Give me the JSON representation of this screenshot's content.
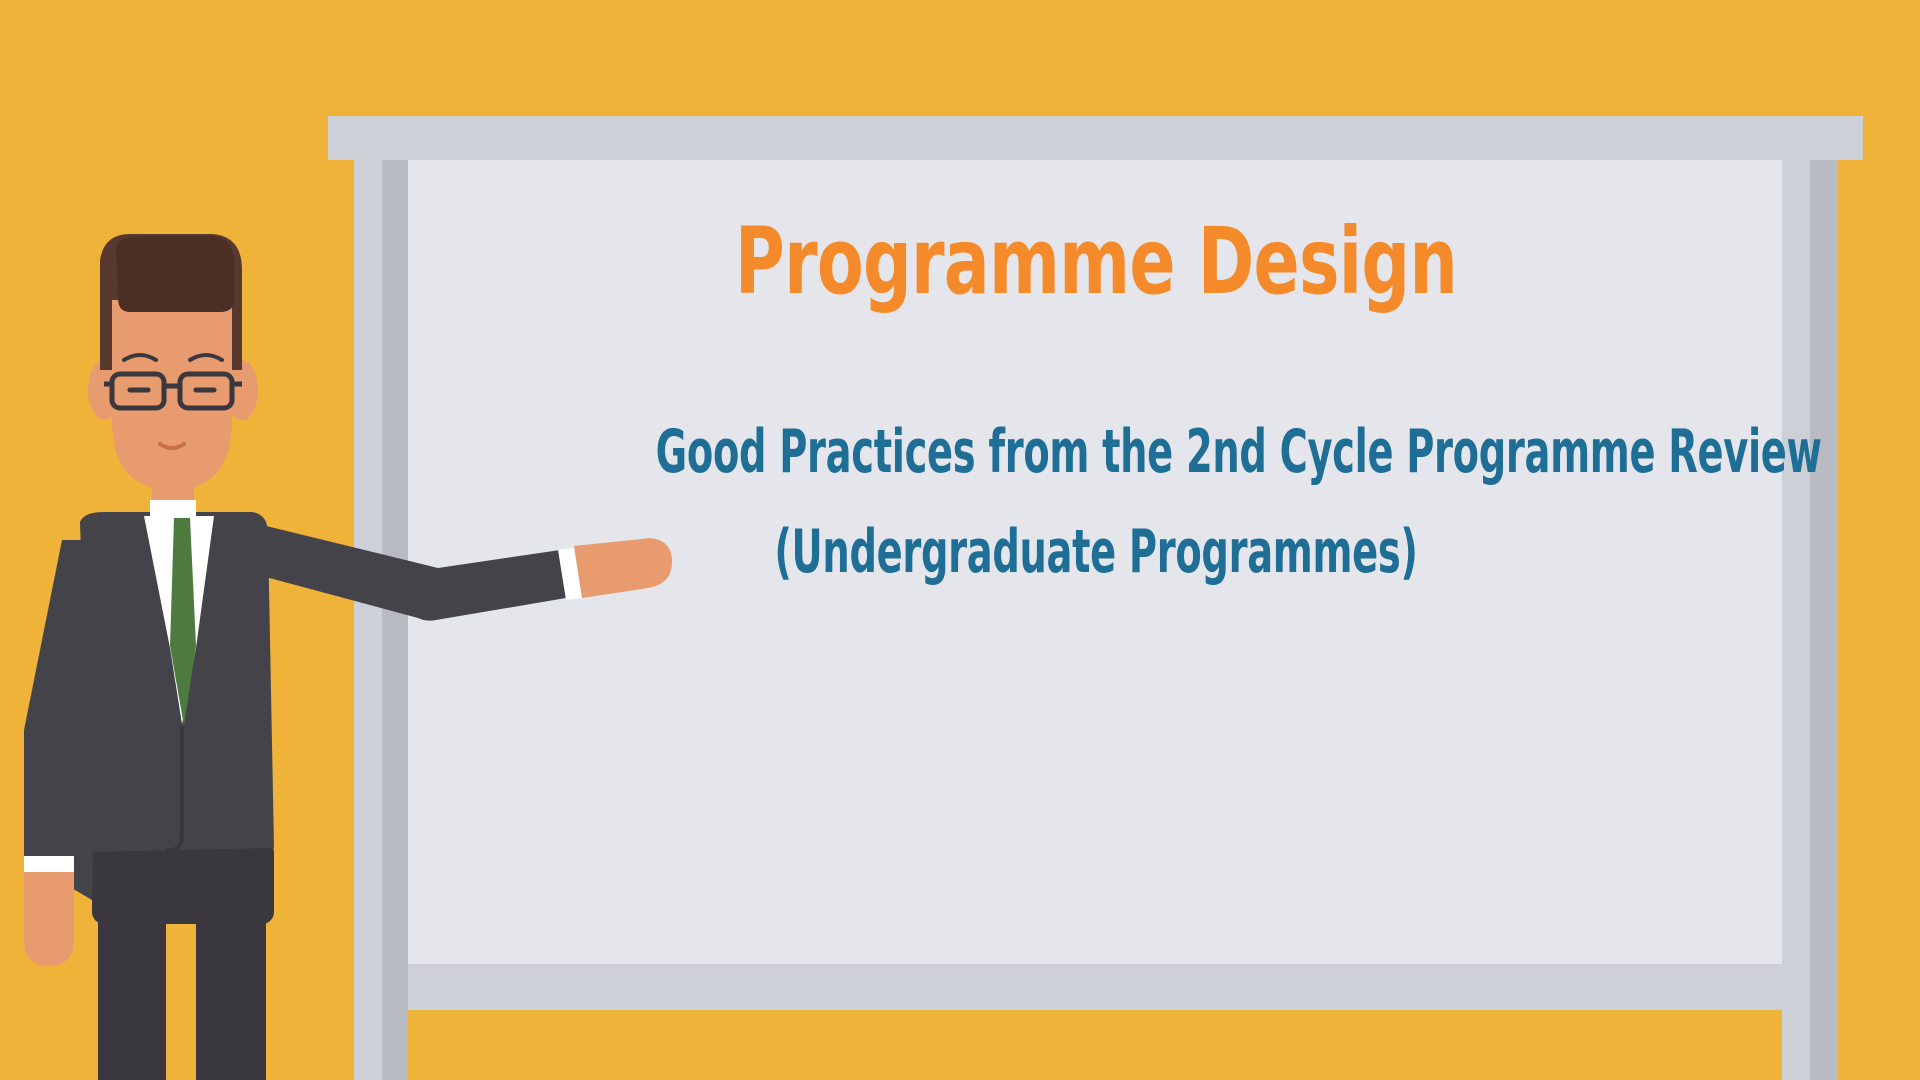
{
  "board": {
    "title": "Programme Design",
    "subtitle_line1": "Good Practices from the 2nd Cycle Programme Review",
    "subtitle_line2": "(Undergraduate Programmes)"
  },
  "colors": {
    "background": "#F0B33A",
    "board_surface": "#E5E6EB",
    "board_frame": "#CDD0D7",
    "board_frame_shadow": "#B9BBC2",
    "title": "#F58A2B",
    "subtitle": "#1F6E96",
    "suit": "#45434A",
    "tie": "#4D7A3F",
    "skin": "#E89B6E",
    "hair": "#58392F"
  },
  "character": {
    "description_icon": "presenter-man-icon"
  }
}
